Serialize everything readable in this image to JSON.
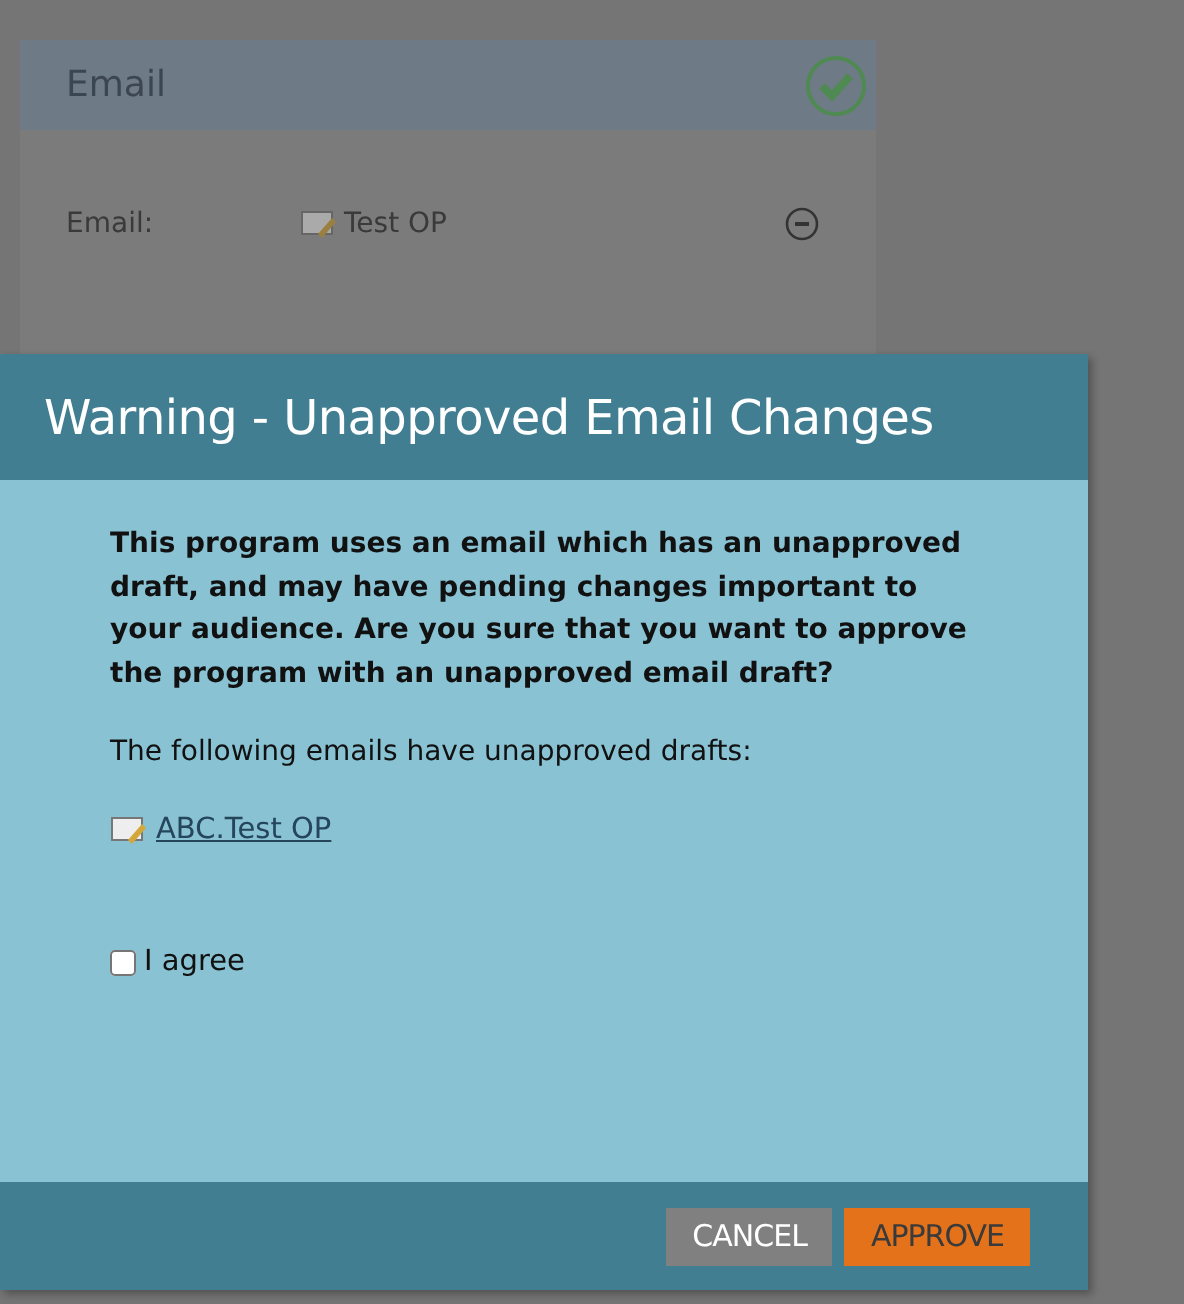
{
  "background_card": {
    "title": "Email",
    "approved": true,
    "field_label": "Email:",
    "field_value": "Test OP"
  },
  "dialog": {
    "title": "Warning - Unapproved Email Changes",
    "message": "This program uses an email which has an unapproved draft, and may have pending changes important to your audience. Are you sure that you want to approve the program with an unapproved email draft?",
    "list_intro": "The following emails have unapproved drafts:",
    "emails": [
      "ABC.Test OP"
    ],
    "agree": {
      "label": "I agree",
      "checked": false
    },
    "buttons": [
      {
        "label": "CANCEL",
        "kind": "secondary"
      },
      {
        "label": "APPROVE",
        "kind": "primary"
      }
    ]
  }
}
